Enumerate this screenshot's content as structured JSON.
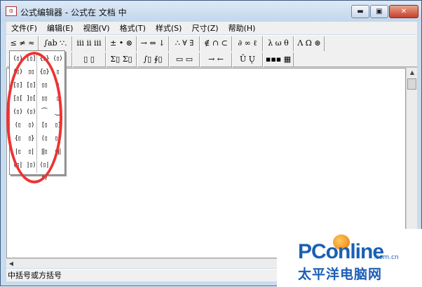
{
  "window": {
    "title": "公式编辑器 - 公式在 文档 中",
    "app_icon": "α",
    "controls": {
      "minimize": "▬",
      "maximize": "▣",
      "close": "✕"
    }
  },
  "menu": [
    "文件(F)",
    "编辑(E)",
    "视图(V)",
    "格式(T)",
    "样式(S)",
    "尺寸(Z)",
    "帮助(H)"
  ],
  "toolbar": {
    "row1": [
      "≤ ≠ ≈",
      "∫ab ∵.",
      "ⅲ ⅱ ⅲ",
      "± • ⊗",
      "→ ⇔ ↓",
      "∴ ∀ ∃",
      "∉ ∩ ⊂",
      "∂ ∞ ℓ",
      "λ ω θ",
      "Λ Ω ⊛"
    ],
    "row2": [
      "(▯) [▯]",
      "▯ √▯",
      "▯ ▯",
      "Σ▯ Σ▯",
      "∫▯ ∮▯",
      "▭ ▭",
      "→ ←",
      "Ū Ų",
      "▪▪▪ ▦"
    ]
  },
  "palette": {
    "cells": [
      [
        "(▯)",
        "[▯]",
        "{▯}",
        "⟨▯⟩"
      ],
      [
        "(▯)",
        "▯▯",
        "{▯}",
        "▯"
      ],
      [
        "[▯]",
        "[▯]",
        "▯▯",
        "▯"
      ],
      [
        "[▯[",
        "]▯[",
        "▯▯",
        "▯"
      ],
      [
        "(▯)",
        "(▯)",
        "⏜",
        "⏝"
      ],
      [
        "(▯",
        "▯)",
        "[▯",
        "▯]"
      ],
      [
        "{▯",
        "▯}",
        "⟨▯",
        "▯⟩"
      ],
      [
        "|▯",
        "▯|",
        "‖▯",
        "▯‖"
      ],
      [
        "⟨▯|",
        "|▯⟩",
        "⟨▯|▯⟩",
        ""
      ]
    ]
  },
  "status": {
    "text": "中括号或方括号"
  },
  "watermark": {
    "brand": "PConline",
    "domain": ".com.cn",
    "subtitle": "太平洋电脑网"
  },
  "colors": {
    "annotation": "#e33333",
    "brand": "#1b5fb4"
  }
}
